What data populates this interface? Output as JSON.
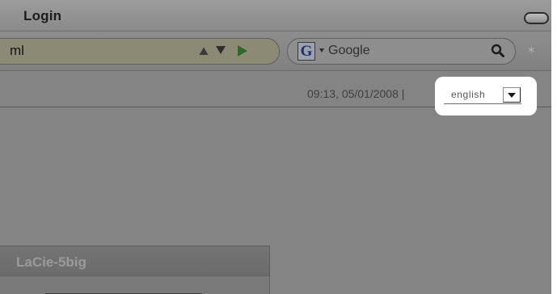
{
  "window": {
    "title": "Login"
  },
  "toolbar": {
    "url_text": "ml",
    "search_placeholder": "Google",
    "search_engine_icon": "google-g-icon"
  },
  "header": {
    "datetime": "09:13, 05/01/2008 |",
    "language": {
      "selected": "english"
    }
  },
  "panel": {
    "title": "LaCie-5big"
  },
  "colors": {
    "highlight": "#ffffff",
    "window_bg": "#848484"
  }
}
